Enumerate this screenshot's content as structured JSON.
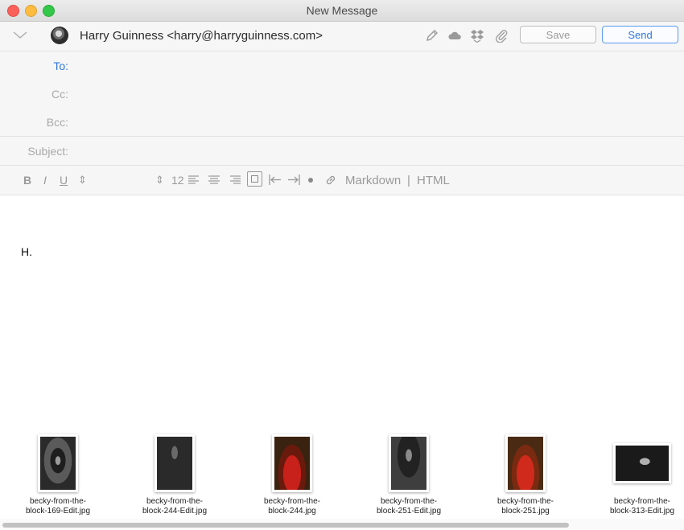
{
  "window": {
    "title": "New Message"
  },
  "from": {
    "sender": "Harry Guinness <harry@harryguinness.com>"
  },
  "toolbar": {
    "icons": [
      "pencil-icon",
      "cloud-icon",
      "dropbox-icon",
      "paperclip-icon"
    ],
    "save_label": "Save",
    "send_label": "Send",
    "accent_color": "#2f78e0"
  },
  "fields": {
    "to_label": "To:",
    "cc_label": "Cc:",
    "bcc_label": "Bcc:",
    "subject_label": "Subject:",
    "to_value": "",
    "cc_value": "",
    "bcc_value": "",
    "subject_value": ""
  },
  "format": {
    "bold": "B",
    "italic": "I",
    "underline": "U",
    "stepper_glyph": "⇕",
    "font_size": "12",
    "markdown_label": "Markdown",
    "separator": "|",
    "html_label": "HTML"
  },
  "body": {
    "text": "H."
  },
  "attachments": [
    {
      "line1": "becky-from-the-",
      "line2": "block-169-Edit.jpg"
    },
    {
      "line1": "becky-from-the-",
      "line2": "block-244-Edit.jpg"
    },
    {
      "line1": "becky-from-the-",
      "line2": "block-244.jpg"
    },
    {
      "line1": "becky-from-the-",
      "line2": "block-251-Edit.jpg"
    },
    {
      "line1": "becky-from-the-",
      "line2": "block-251.jpg"
    },
    {
      "line1": "becky-from-the-",
      "line2": "block-313-Edit.jpg"
    }
  ]
}
